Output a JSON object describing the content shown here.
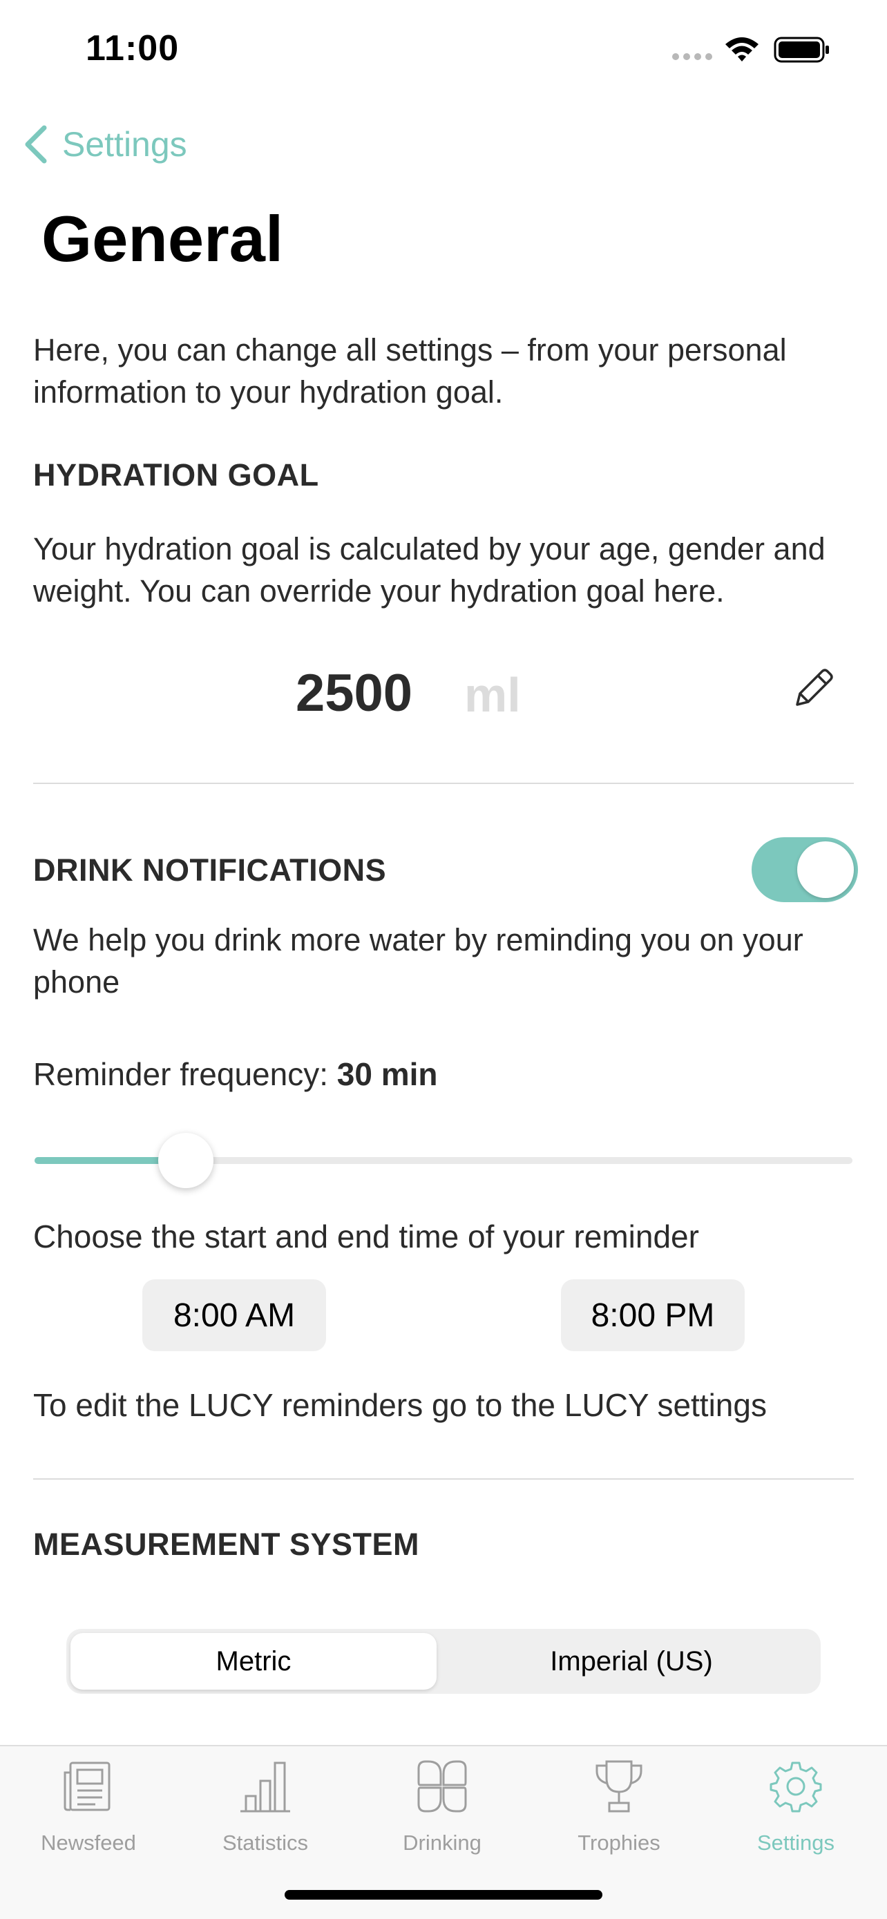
{
  "status_bar": {
    "time": "11:00"
  },
  "nav": {
    "back_label": "Settings"
  },
  "page": {
    "title": "General",
    "intro": "Here, you can change all settings – from your personal information to your hydration goal."
  },
  "hydration": {
    "title": "HYDRATION GOAL",
    "description": "Your hydration goal is calculated by your age, gender and weight. You can override your hydration goal here.",
    "value": "2500",
    "unit": "ml"
  },
  "notifications": {
    "title": "DRINK NOTIFICATIONS",
    "enabled": true,
    "description": "We help you drink more water by reminding you on your phone",
    "frequency_label": "Reminder frequency:",
    "frequency_value": "30 min",
    "frequency_fraction": 0.185,
    "time_range_label": "Choose the start and end time of your reminder",
    "start_time": "8:00 AM",
    "end_time": "8:00 PM",
    "lucy_note": "To edit the LUCY reminders go to the LUCY settings"
  },
  "measurement": {
    "title": "MEASUREMENT SYSTEM",
    "options": [
      "Metric",
      "Imperial (US)"
    ],
    "selected": "Metric"
  },
  "tabs": [
    {
      "label": "Newsfeed",
      "icon": "newsfeed-icon"
    },
    {
      "label": "Statistics",
      "icon": "bar-chart-icon"
    },
    {
      "label": "Drinking",
      "icon": "drinking-icon"
    },
    {
      "label": "Trophies",
      "icon": "trophy-icon"
    },
    {
      "label": "Settings",
      "icon": "gear-icon",
      "active": true
    }
  ],
  "colors": {
    "accent": "#7cc8bd",
    "text": "#2b2b2b",
    "muted": "#9e9e9e",
    "divider": "#dcdcdc"
  }
}
